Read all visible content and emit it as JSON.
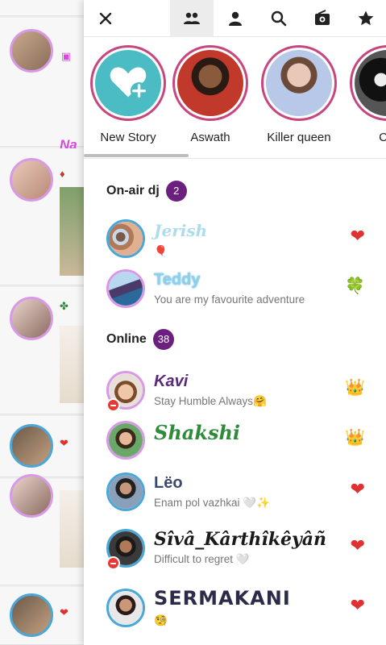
{
  "topbar": {
    "icons": [
      "close-icon",
      "group-icon",
      "person-icon",
      "search-icon",
      "radio-icon",
      "star-icon"
    ]
  },
  "stories": [
    {
      "label": "New Story",
      "type": "new"
    },
    {
      "label": "Aswath"
    },
    {
      "label": "Killer queen"
    },
    {
      "label": "CH"
    }
  ],
  "on_air": {
    "title": "On-air dj",
    "count": "2",
    "users": [
      {
        "name": "Jerish",
        "status": "🎈",
        "badge": "❤",
        "name_color": "#9fd6ea"
      },
      {
        "name": "Teddy",
        "status": "You are my favourite adventure",
        "badge": "🍀",
        "name_color": "#8ad0f0"
      }
    ]
  },
  "online": {
    "title": "Online",
    "count": "38",
    "users": [
      {
        "name": "Kavi",
        "status": "Stay Humble Always🤗",
        "badge": "👑",
        "name_color": "#5a2a7a",
        "muted": true
      },
      {
        "name": "Shakshi",
        "status": "",
        "badge": "👑",
        "name_color": "#2e8b3a"
      },
      {
        "name": "Lëo",
        "status": "Enam pol vazhkai 🤍✨",
        "badge": "❤",
        "name_color": "#3a4a6a"
      },
      {
        "name": "Sîvâ_Kârthîkêyâñ",
        "status": "Difficult to regret 🤍",
        "badge": "❤",
        "name_color": "#1a1a1a",
        "muted": true
      },
      {
        "name": "SERMAKANI",
        "status": "🧐",
        "badge": "❤",
        "name_color": "#2c2c4a"
      }
    ]
  },
  "feed": {
    "partial_name": "Na"
  },
  "colors": {
    "badge_bg": "#6c1f7e",
    "story_ring": "#c8467f",
    "new_story_bg": "#4bbcc3",
    "heart": "#e03131"
  }
}
